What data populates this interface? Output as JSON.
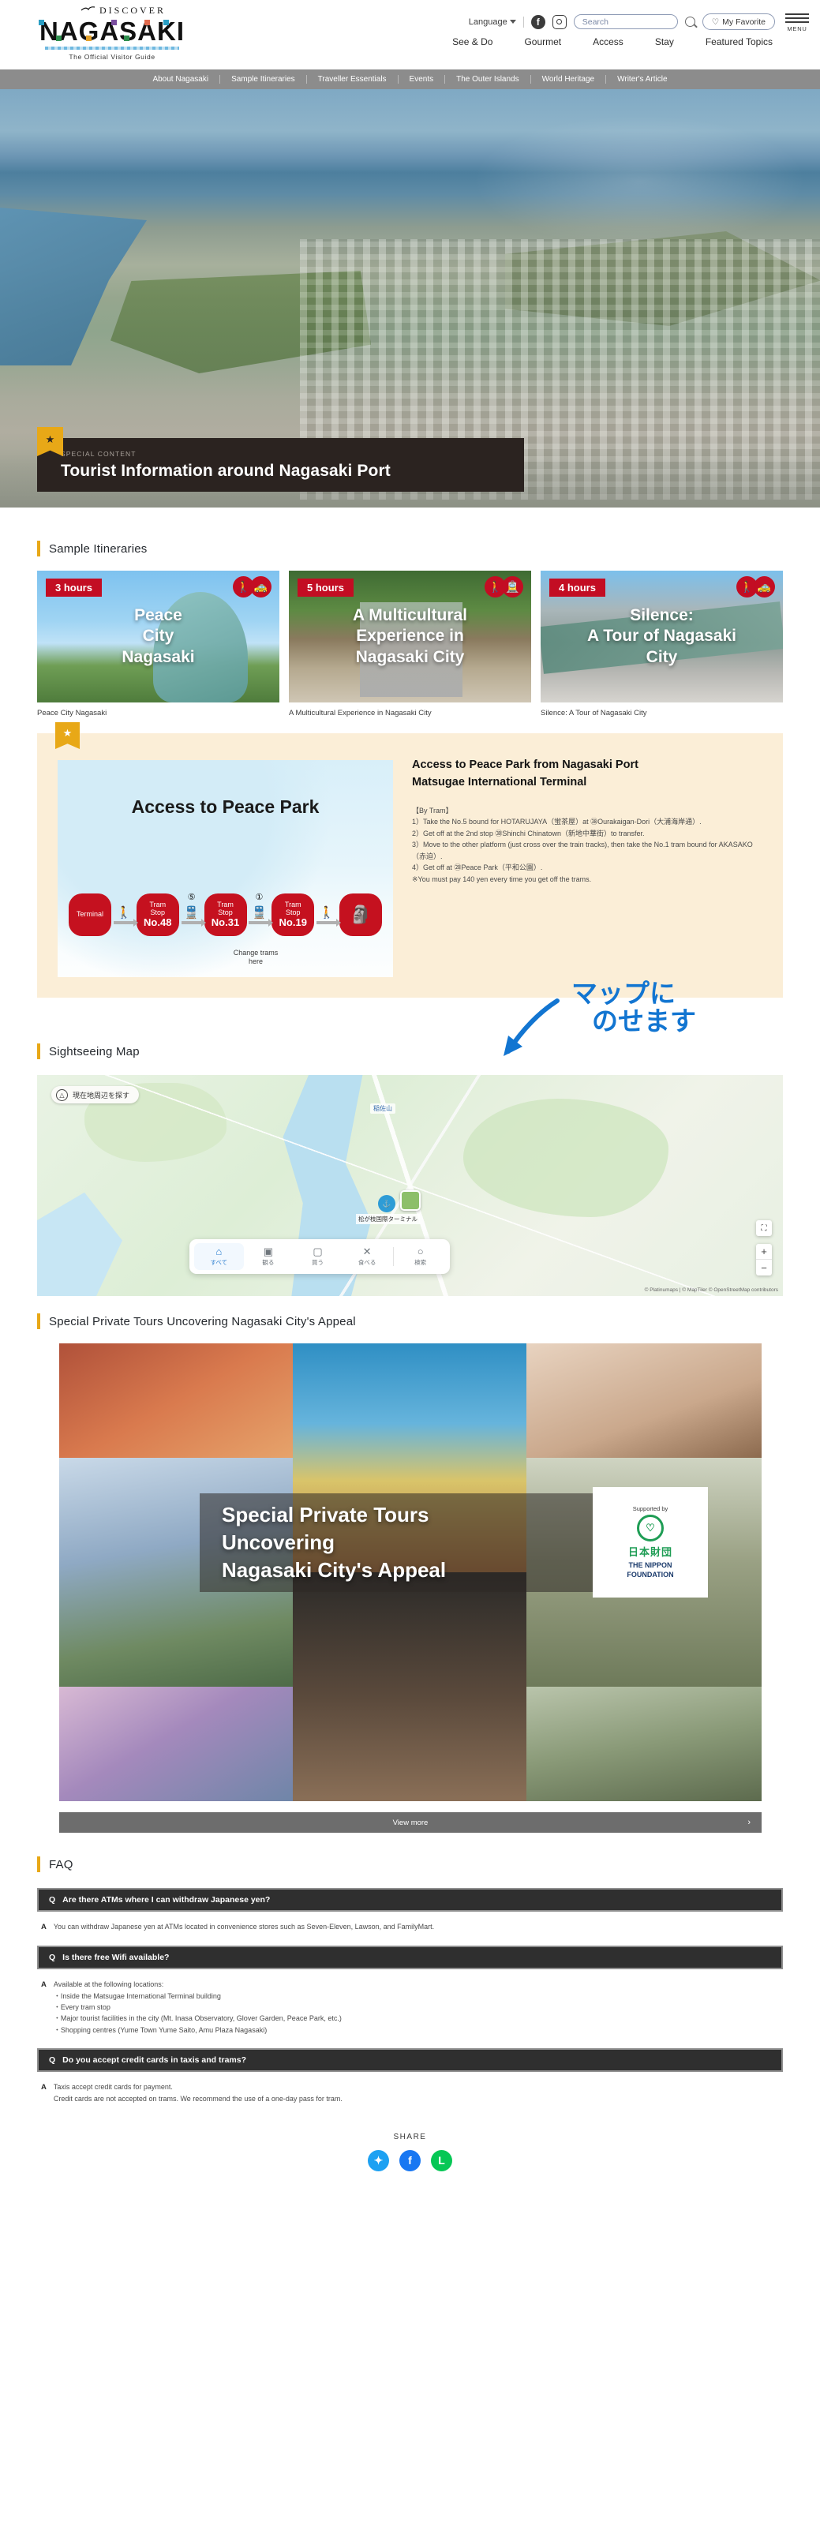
{
  "header": {
    "logo": {
      "discover": "DISCOVER",
      "name": "NAGASAKI",
      "sub": "The Official Visitor Guide",
      "bird_icon": "bird-icon"
    },
    "language_label": "Language",
    "facebook_icon": "facebook-icon",
    "instagram_icon": "instagram-icon",
    "search_placeholder": "Search",
    "search_value": "",
    "search_icon": "search-icon",
    "favorite_label": "My Favorite",
    "heart_icon": "heart-icon",
    "menu_label": "MENU",
    "main_nav": [
      "See & Do",
      "Gourmet",
      "Access",
      "Stay",
      "Featured Topics"
    ]
  },
  "category_nav": [
    "About Nagasaki",
    "Sample Itineraries",
    "Traveller Essentials",
    "Events",
    "The Outer Islands",
    "World Heritage",
    "Writer's Article"
  ],
  "hero": {
    "kicker": "SPECIAL CONTENT",
    "title": "Tourist Information around Nagasaki Port",
    "flag_icon": "star-icon"
  },
  "itineraries": {
    "heading": "Sample Itineraries",
    "cards": [
      {
        "hours": "3 hours",
        "title": "Peace\nCity\nNagasaki",
        "caption": "Peace City Nagasaki",
        "icons": [
          "walk-icon",
          "taxi-icon"
        ]
      },
      {
        "hours": "5 hours",
        "title": "A Multicultural\nExperience in\nNagasaki City",
        "caption": "A Multicultural Experience in Nagasaki City",
        "icons": [
          "walk-icon",
          "tram-icon"
        ]
      },
      {
        "hours": "4 hours",
        "title": "Silence:\nA Tour of Nagasaki\nCity",
        "caption": "Silence: A Tour of Nagasaki City",
        "icons": [
          "walk-icon",
          "taxi-icon"
        ]
      }
    ]
  },
  "access": {
    "star_icon": "star-icon",
    "map_title": "Access to Peace Park",
    "flow": [
      {
        "type": "node",
        "label": "Terminal"
      },
      {
        "type": "conn",
        "glyph": "walk-icon",
        "num": ""
      },
      {
        "type": "node",
        "label": "Tram\nStop",
        "big": "No.48"
      },
      {
        "type": "conn",
        "glyph": "tram-icon",
        "num": "⑤"
      },
      {
        "type": "node",
        "label": "Tram\nStop",
        "big": "No.31"
      },
      {
        "type": "conn",
        "glyph": "tram-icon",
        "num": "①"
      },
      {
        "type": "node",
        "label": "Tram\nStop",
        "big": "No.19"
      },
      {
        "type": "conn",
        "glyph": "walk-icon",
        "num": ""
      },
      {
        "type": "node",
        "label": "peace-statue-icon"
      }
    ],
    "change_note": "Change trams\nhere",
    "title": "Access to Peace Park from Nagasaki Port\nMatsugae International Terminal",
    "body": "【By Tram】\n1）Take the No.5 bound for HOTARUJAYA（蛍茶屋）at ㊳Ourakaigan-Dori（大浦海岸通）.\n2）Get off at the 2nd stop ㉚Shinchi Chinatown（新地中華街）to transfer.\n3）Move to the other platform (just cross over the train tracks), then take the No.1 tram bound for AKASAKO（赤迫）.\n4）Get off at ㉘Peace Park（平和公園）.\n※You must pay 140 yen every time you get off the trams."
  },
  "sightseeing": {
    "heading": "Sightseeing Map",
    "annotation_line1": "マップに",
    "annotation_line2": "のせます",
    "loc_button": "現在地周辺を探す",
    "loc_icon": "locate-icon",
    "top_pin_label": "稲佐山",
    "pin_label": "松が枝国際ターミナル",
    "tabs": [
      {
        "label": "すべて",
        "icon": "home-icon",
        "active": true
      },
      {
        "label": "観る",
        "icon": "camera-icon",
        "active": false
      },
      {
        "label": "買う",
        "icon": "shopping-bag-icon",
        "active": false
      },
      {
        "label": "食べる",
        "icon": "cutlery-icon",
        "active": false
      },
      {
        "label": "検索",
        "icon": "search-icon",
        "active": false
      }
    ],
    "zoom_in": "+",
    "zoom_out": "−",
    "fullscreen_icon": "fullscreen-icon",
    "credit": "© Platinumaps | © MapTiler © OpenStreetMap contributors"
  },
  "tours": {
    "heading": "Special Private Tours Uncovering Nagasaki City's Appeal",
    "title_line1": "Special Private Tours",
    "title_line2": "Uncovering",
    "title_line3": "Nagasaki City's Appeal",
    "nippon": {
      "supported": "Supported by",
      "mark_icon": "nippon-foundation-icon",
      "jp": "日本財団",
      "en": "THE NIPPON\nFOUNDATION"
    },
    "view_more": "View more",
    "chevron_icon": "chevron-right-icon"
  },
  "faq": {
    "heading": "FAQ",
    "q_marker": "Q",
    "a_marker": "A",
    "items": [
      {
        "question": "Are there ATMs where I can withdraw Japanese yen?",
        "answer": [
          "You can withdraw Japanese yen at ATMs located in convenience stores such as Seven-Eleven, Lawson, and FamilyMart."
        ]
      },
      {
        "question": "Is there free Wifi available?",
        "answer": [
          "Available at the following locations:",
          "・Inside the Matsugae International Terminal building",
          "・Every tram stop",
          "・Major tourist facilities in the city (Mt. Inasa Observatory, Glover Garden, Peace Park, etc.)",
          "・Shopping centres (Yume Town Yume Saito, Amu Plaza Nagasaki)"
        ]
      },
      {
        "question": "Do you accept credit cards in taxis and trams?",
        "answer": [
          "Taxis accept credit cards for payment.",
          "Credit cards are not accepted on trams. We recommend the use of a one-day pass for tram."
        ]
      }
    ]
  },
  "share": {
    "label": "SHARE",
    "buttons": [
      {
        "icon": "twitter-icon",
        "color": "#1da1f2",
        "glyph": "🐦"
      },
      {
        "icon": "facebook-icon",
        "color": "#1877f2",
        "glyph": "f"
      },
      {
        "icon": "line-icon",
        "color": "#06c755",
        "glyph": "L"
      }
    ]
  }
}
